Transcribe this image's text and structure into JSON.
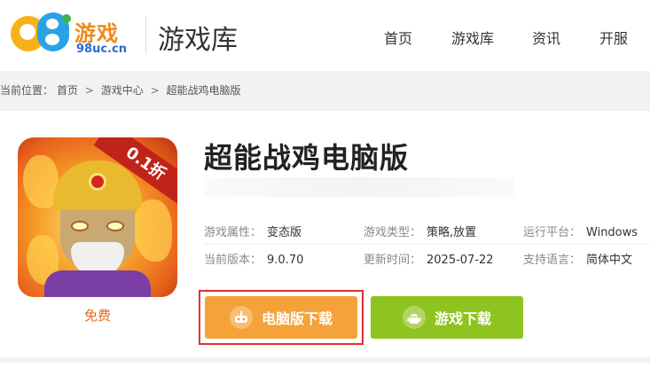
{
  "site": {
    "logo_text": "游戏",
    "logo_domain": "98uc.cn",
    "section_title": "游戏库"
  },
  "nav": {
    "items": [
      {
        "label": "首页"
      },
      {
        "label": "游戏库"
      },
      {
        "label": "资讯"
      },
      {
        "label": "开服"
      }
    ]
  },
  "breadcrumb": {
    "prefix": "当前位置：",
    "items": [
      "首页",
      "游戏中心",
      "超能战鸡电脑版"
    ],
    "separator": ">"
  },
  "game": {
    "title": "超能战鸡电脑版",
    "icon_badge": "0.1折",
    "price_label": "免费",
    "attributes": [
      {
        "key": "游戏属性：",
        "value": "变态版"
      },
      {
        "key": "游戏类型：",
        "value": "策略,放置"
      },
      {
        "key": "运行平台：",
        "value": "Windows"
      },
      {
        "key": "当前版本：",
        "value": "9.0.70"
      },
      {
        "key": "更新时间：",
        "value": "2025-07-22"
      },
      {
        "key": "支持语言：",
        "value": "简体中文"
      }
    ]
  },
  "buttons": {
    "pc_download": "电脑版下载",
    "game_download": "游戏下载"
  },
  "colors": {
    "pc_button": "#f5a23a",
    "game_button": "#8fc31f",
    "highlight_outline": "#e02f2f",
    "free_label": "#e56a16"
  }
}
